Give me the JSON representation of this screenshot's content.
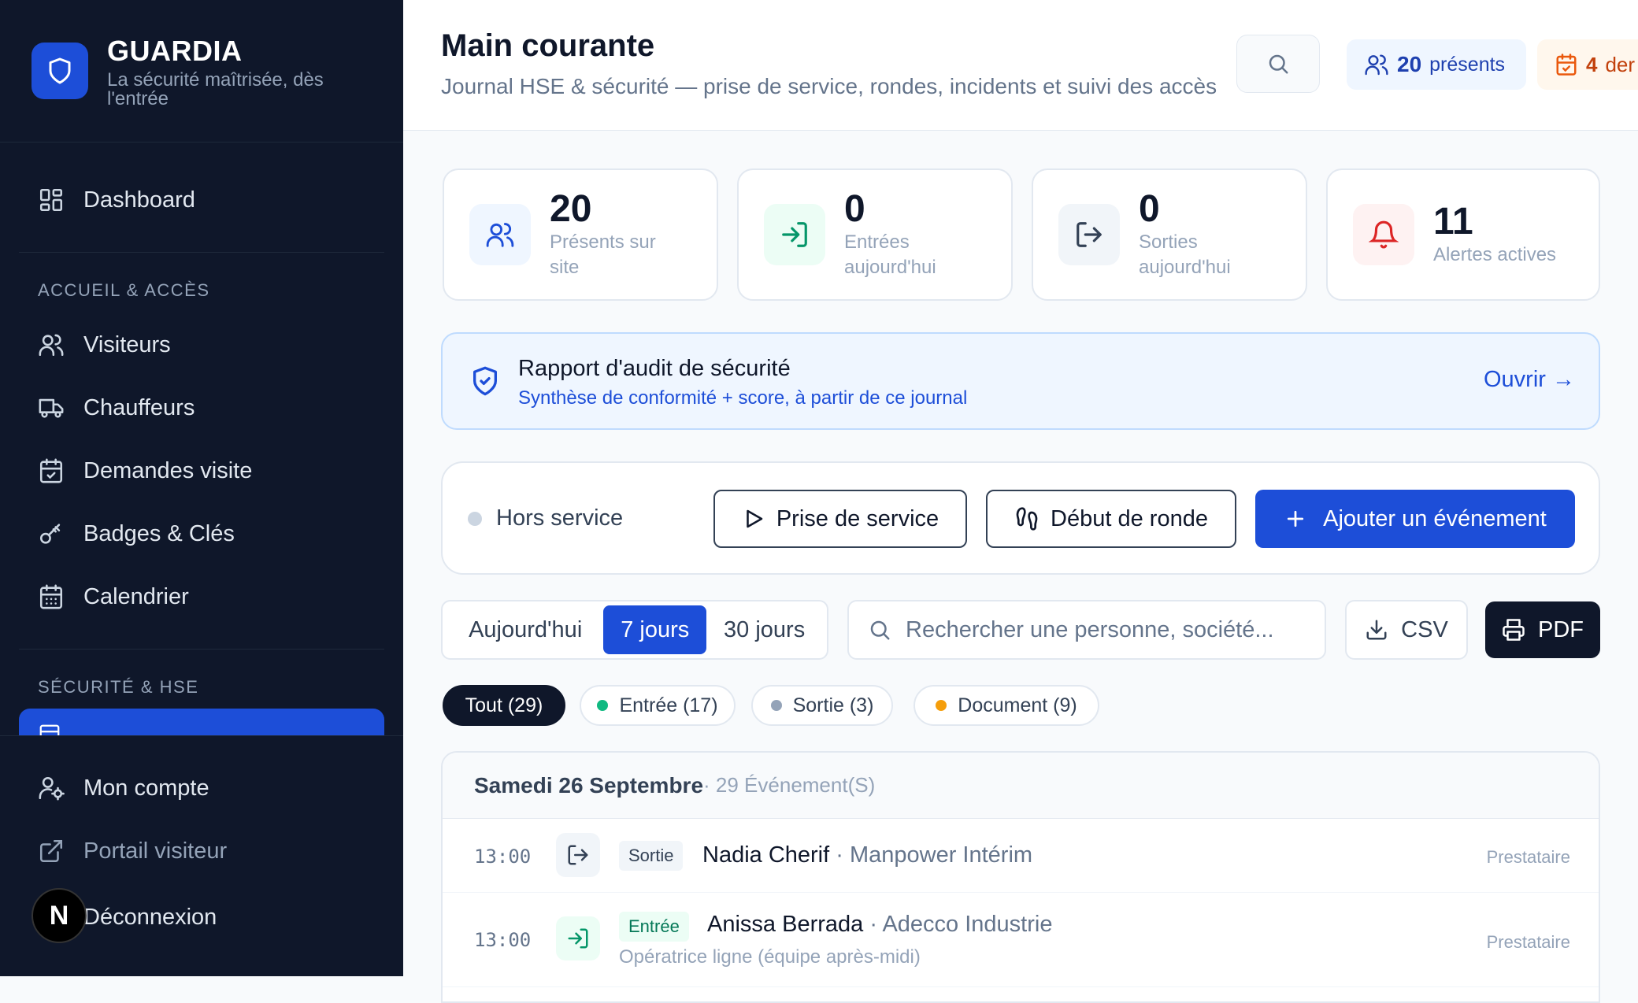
{
  "brand": {
    "name": "GUARDIA",
    "tagline": "La sécurité maîtrisée, dès l'entrée"
  },
  "sidebar": {
    "dashboard": "Dashboard",
    "section_access": "ACCUEIL & ACCÈS",
    "items_access": [
      {
        "label": "Visiteurs",
        "icon": "users-icon"
      },
      {
        "label": "Chauffeurs",
        "icon": "truck-icon"
      },
      {
        "label": "Demandes visite",
        "icon": "calendar-check-icon"
      },
      {
        "label": "Badges & Clés",
        "icon": "key-icon"
      },
      {
        "label": "Calendrier",
        "icon": "calendar-icon"
      }
    ],
    "section_security": "SÉCURITÉ & HSE",
    "bottom": {
      "account": "Mon compte",
      "portal": "Portail visiteur",
      "logout": "Déconnexion"
    },
    "badge_letter": "N"
  },
  "header": {
    "title": "Main courante",
    "subtitle": "Journal HSE & sécurité — prise de service, rondes, incidents et suivi des accès",
    "present_count": "20",
    "present_label": "présents",
    "demand_count": "4",
    "demand_label": "der"
  },
  "stats": [
    {
      "value": "20",
      "label": "Présents sur site",
      "icon": "users-icon",
      "color": "#1d4ed8"
    },
    {
      "value": "0",
      "label": "Entrées aujourd'hui",
      "icon": "log-in-icon",
      "color": "#059669"
    },
    {
      "value": "0",
      "label": "Sorties aujourd'hui",
      "icon": "log-out-icon",
      "color": "#334155"
    },
    {
      "value": "11",
      "label": "Alertes actives",
      "icon": "bell-icon",
      "color": "#dc2626"
    }
  ],
  "audit": {
    "title": "Rapport d'audit de sécurité",
    "subtitle": "Synthèse de conformité + score, à partir de ce journal",
    "link": "Ouvrir →"
  },
  "service": {
    "status": "Hors service",
    "start_service": "Prise de service",
    "start_round": "Début de ronde",
    "add_event": "Ajouter un événement"
  },
  "filters": {
    "periods": [
      "Aujourd'hui",
      "7 jours",
      "30 jours"
    ],
    "active_period": "7 jours",
    "search_placeholder": "Rechercher une personne, société...",
    "csv": "CSV",
    "pdf": "PDF",
    "chips": [
      {
        "label": "Tout (29)",
        "active": true
      },
      {
        "label": "Entrée (17)",
        "dot": "#10b981"
      },
      {
        "label": "Sortie (3)",
        "dot": "#94a3b8"
      },
      {
        "label": "Document (9)",
        "dot": "#f59e0b"
      }
    ]
  },
  "feed": {
    "date": "Samedi 26 Septembre",
    "count": " · 29 Événement(S)",
    "rows": [
      {
        "time": "13:00",
        "tag": "Sortie",
        "name": "Nadia Cherif",
        "company": " · Manpower Intérim",
        "detail": "",
        "role": "Prestataire"
      },
      {
        "time": "13:00",
        "tag": "Entrée",
        "name": "Anissa Berrada",
        "company": " · Adecco Industrie",
        "detail": "Opératrice ligne (équipe après-midi)",
        "role": "Prestataire"
      }
    ]
  }
}
